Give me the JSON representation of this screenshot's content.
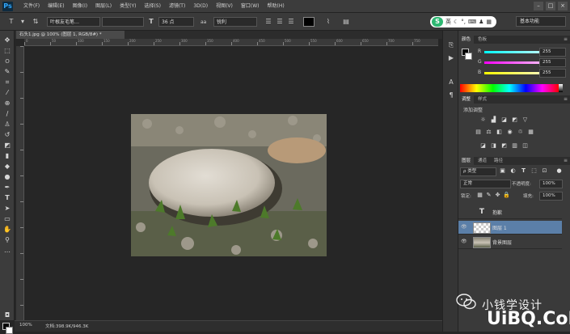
{
  "app": {
    "logo": "Ps",
    "menus": [
      "文件(F)",
      "编辑(E)",
      "图像(I)",
      "图层(L)",
      "类型(Y)",
      "选择(S)",
      "滤镜(T)",
      "3D(D)",
      "视图(V)",
      "窗口(W)",
      "帮助(H)"
    ]
  },
  "options": {
    "tool_icon": "T",
    "font_family": "叶根友毛笔…",
    "font_size": "36 点",
    "aa_label": "aa",
    "aa_mode": "锐利",
    "workspace": "基本功能",
    "ime_text": "英"
  },
  "document": {
    "tab_title": "石头1.jpg @ 100% (图层 1, RGB/8#) *",
    "zoom": "100%",
    "doc_info": "文档:398.9K/946.3K",
    "ruler_numbers": [
      "0",
      "50",
      "100",
      "150",
      "200",
      "250",
      "300",
      "350",
      "400",
      "450",
      "500",
      "550",
      "600",
      "650",
      "700",
      "750",
      "800"
    ]
  },
  "color_panel": {
    "tabs": [
      "颜色",
      "色板"
    ],
    "channels": [
      {
        "label": "R",
        "value": "255"
      },
      {
        "label": "G",
        "value": "255"
      },
      {
        "label": "B",
        "value": "255"
      }
    ]
  },
  "adjust_panel": {
    "tabs": [
      "调整",
      "样式"
    ],
    "title": "添加调整"
  },
  "layers_panel": {
    "tabs": [
      "图层",
      "通道",
      "路径"
    ],
    "kind": "ρ 类型",
    "blend": "正常",
    "opacity_label": "不透明度:",
    "opacity": "100%",
    "lock_label": "锁定:",
    "fill_label": "填充:",
    "fill": "100%",
    "layers": [
      {
        "name": "抱歉",
        "kind": "text"
      },
      {
        "name": "图层 1",
        "kind": "pixel",
        "selected": true
      },
      {
        "name": "背景图层",
        "kind": "photo"
      }
    ]
  },
  "watermark": {
    "text": "小钱学设计",
    "site": "UiBQ.CoM"
  },
  "colors": {
    "accent": "#31a8ff",
    "selected_layer": "#5b7fa8"
  }
}
